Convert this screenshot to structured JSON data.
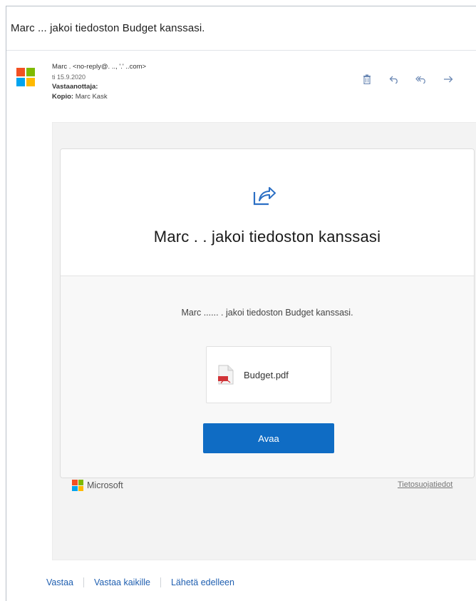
{
  "email": {
    "subject": "Marc ... jakoi tiedoston Budget kanssasi.",
    "sender": "Marc .      <no-reply@. .., '.' ..com>",
    "date": "ti 15.9.2020",
    "to_label": "Vastaanottaja:",
    "cc_label": "Kopio:",
    "cc_value": "Marc Kask"
  },
  "toolbar": {
    "delete_icon": "trash-icon",
    "reply_icon": "reply-icon",
    "reply_all_icon": "reply-all-icon",
    "forward_icon": "forward-icon"
  },
  "card": {
    "title": "Marc .       . jakoi tiedoston kanssasi",
    "message": "Marc ...... . jakoi tiedoston Budget kanssasi.",
    "file_name": "Budget.pdf",
    "open_button": "Avaa"
  },
  "footer": {
    "brand": "Microsoft",
    "privacy_link": "Tietosuojatiedot"
  },
  "reply_bar": {
    "reply": "Vastaa",
    "reply_all": "Vastaa kaikille",
    "forward": "Lähetä edelleen"
  },
  "colors": {
    "accent": "#0f6cc4",
    "link": "#1f5fb0",
    "ms_red": "#f25022",
    "ms_green": "#7fba00",
    "ms_blue": "#00a4ef",
    "ms_yellow": "#ffb900"
  }
}
